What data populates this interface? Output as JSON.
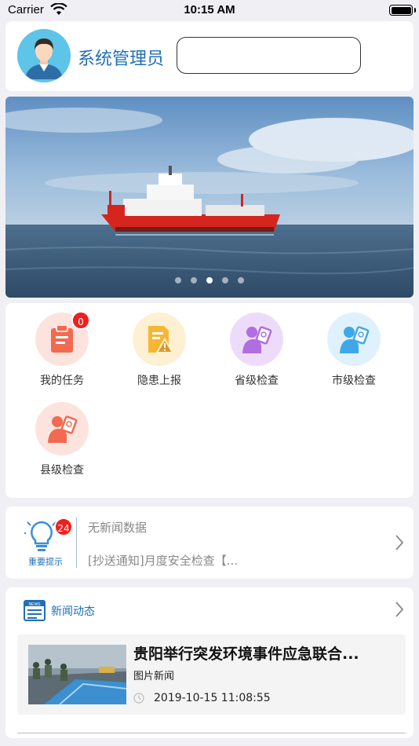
{
  "status_bar": {
    "carrier": "Carrier",
    "time": "10:15 AM"
  },
  "profile": {
    "username": "系统管理员"
  },
  "banner": {
    "slide_count": 5,
    "active_slide": 3
  },
  "menu": {
    "items": [
      {
        "label": "我的任务",
        "badge": "0",
        "icon": "clipboard-icon",
        "color": "#f26a4f"
      },
      {
        "label": "隐患上报",
        "icon": "warning-document-icon",
        "color": "#f7b733"
      },
      {
        "label": "省级检查",
        "icon": "inspector-icon",
        "color": "#b06ee0"
      },
      {
        "label": "市级检查",
        "icon": "inspector-icon",
        "color": "#3fa8e8"
      },
      {
        "label": "县级检查",
        "icon": "inspector-icon",
        "color": "#f26a4f"
      }
    ]
  },
  "notice": {
    "caption": "重要提示",
    "badge": "24",
    "line1": "无新闻数据",
    "line2": "[抄送通知]月度安全检查【..."
  },
  "news": {
    "section_title": "新闻动态",
    "item": {
      "headline": "贵阳举行突发环境事件应急联合...",
      "category": "图片新闻",
      "date": "2019-10-15 11:08:55"
    }
  },
  "colors": {
    "accent": "#1f6fb8",
    "badge": "#f01e1e"
  }
}
